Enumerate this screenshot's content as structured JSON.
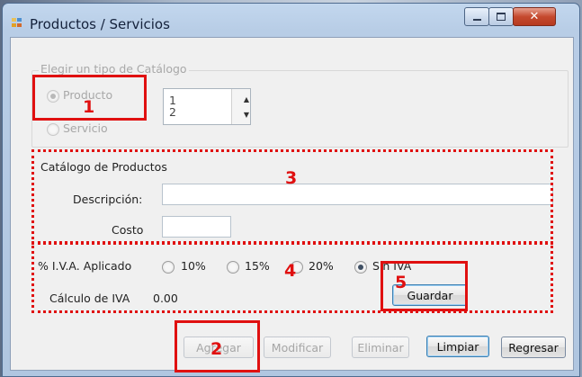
{
  "window": {
    "title": "Productos / Servicios",
    "controls": [
      "minimize-icon",
      "maximize-icon",
      "close-icon"
    ]
  },
  "catalog_type": {
    "legend": "Elegir un tipo de Catálogo",
    "producto_label": "Producto",
    "servicio_label": "Servicio",
    "list_items": [
      "1",
      "2"
    ]
  },
  "productos": {
    "legend": "Catálogo de Productos",
    "descripcion_label": "Descripción:",
    "descripcion_value": "",
    "costo_label": "Costo",
    "costo_value": ""
  },
  "iva": {
    "label": "% I.V.A. Aplicado",
    "options": [
      "10%",
      "15%",
      "20%",
      "Sin IVA"
    ],
    "selected": "Sin IVA",
    "calc_label": "Cálculo de IVA",
    "calc_value": "0.00",
    "guardar_label": "Guardar"
  },
  "actions": {
    "agregar": "Agregar",
    "modificar": "Modificar",
    "eliminar": "Eliminar",
    "limpiar": "Limpiar",
    "regresar": "Regresar"
  },
  "annotations": [
    "1",
    "2",
    "3",
    "4",
    "5"
  ],
  "colors": {
    "annotation_red": "#e01010",
    "title_bar": "#b8cde6"
  }
}
